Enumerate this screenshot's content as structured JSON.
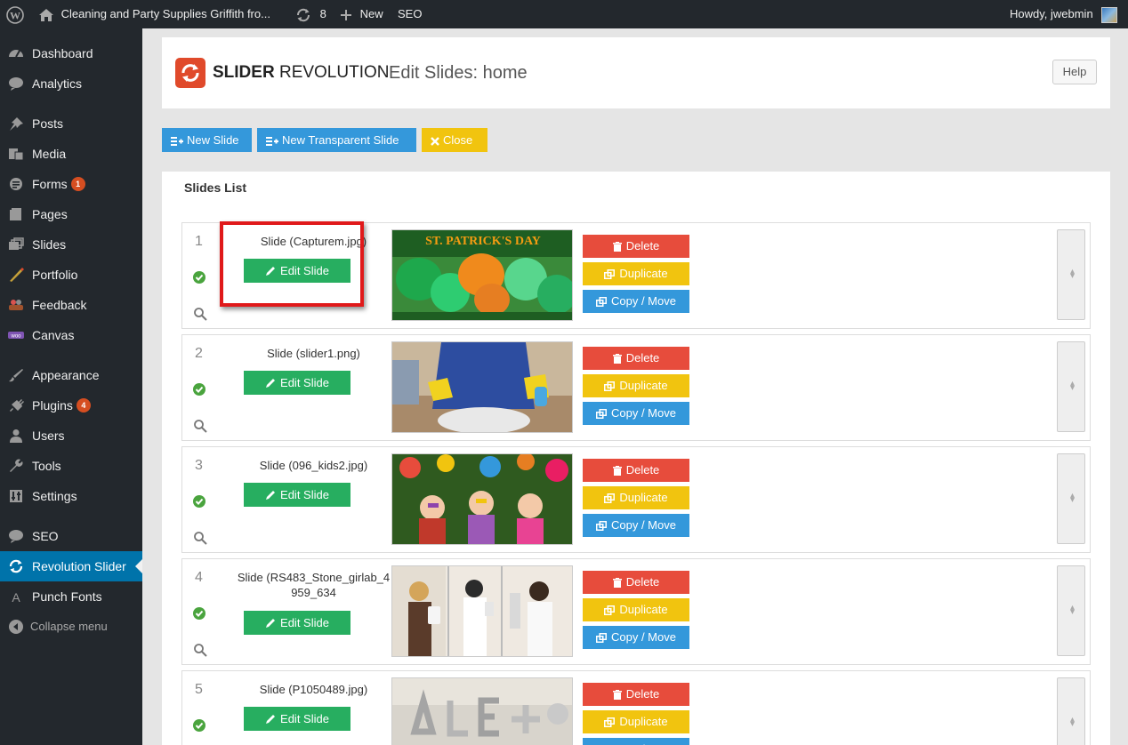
{
  "admin_bar": {
    "site_name": "Cleaning and Party Supplies Griffith fro...",
    "updates_count": "8",
    "new_label": "New",
    "seo_label": "SEO",
    "howdy": "Howdy, jwebmin"
  },
  "sidebar": {
    "items": [
      {
        "label": "Dashboard",
        "icon": "dashboard-icon"
      },
      {
        "label": "Analytics",
        "icon": "analytics-icon"
      },
      {
        "label": "Posts",
        "icon": "pin-icon"
      },
      {
        "label": "Media",
        "icon": "media-icon"
      },
      {
        "label": "Forms",
        "icon": "forms-icon",
        "badge": "1"
      },
      {
        "label": "Pages",
        "icon": "pages-icon"
      },
      {
        "label": "Slides",
        "icon": "slides-icon"
      },
      {
        "label": "Portfolio",
        "icon": "portfolio-icon"
      },
      {
        "label": "Feedback",
        "icon": "feedback-icon"
      },
      {
        "label": "Canvas",
        "icon": "woo-icon"
      },
      {
        "label": "Appearance",
        "icon": "brush-icon"
      },
      {
        "label": "Plugins",
        "icon": "plug-icon",
        "badge": "4"
      },
      {
        "label": "Users",
        "icon": "user-icon"
      },
      {
        "label": "Tools",
        "icon": "wrench-icon"
      },
      {
        "label": "Settings",
        "icon": "settings-icon"
      },
      {
        "label": "SEO",
        "icon": "seo-icon"
      },
      {
        "label": "Revolution Slider",
        "icon": "refresh-icon",
        "current": true
      },
      {
        "label": "Punch Fonts",
        "icon": "font-icon"
      }
    ],
    "collapse_label": "Collapse menu"
  },
  "header": {
    "brand_bold": "SLIDER",
    "brand_light": " REVOLUTION",
    "title": "Edit Slides: home",
    "help_label": "Help"
  },
  "toolbar": {
    "new_slide": "New Slide",
    "new_transparent_slide": "New Transparent Slide",
    "close": "Close"
  },
  "slides_list": {
    "title": "Slides List",
    "edit_label": "Edit Slide",
    "delete_label": "Delete",
    "duplicate_label": "Duplicate",
    "copy_move_label": "Copy / Move",
    "slides": [
      {
        "num": "1",
        "name": "Slide (Capturem.jpg)"
      },
      {
        "num": "2",
        "name": "Slide (slider1.png)"
      },
      {
        "num": "3",
        "name": "Slide (096_kids2.jpg)"
      },
      {
        "num": "4",
        "name": "Slide (RS483_Stone_girlab_4959_634"
      },
      {
        "num": "5",
        "name": "Slide (P1050489.jpg)"
      }
    ]
  },
  "thumb_text": {
    "slide1_banner": "ST. PATRICK'S DAY"
  },
  "colors": {
    "sidebar_bg": "#23282d",
    "current_item": "#0073aa",
    "edit_green": "#27ae60",
    "delete_red": "#e74c3c",
    "duplicate_yellow": "#f1c40f",
    "copy_blue": "#3498db",
    "highlight_red": "#e0191a"
  }
}
